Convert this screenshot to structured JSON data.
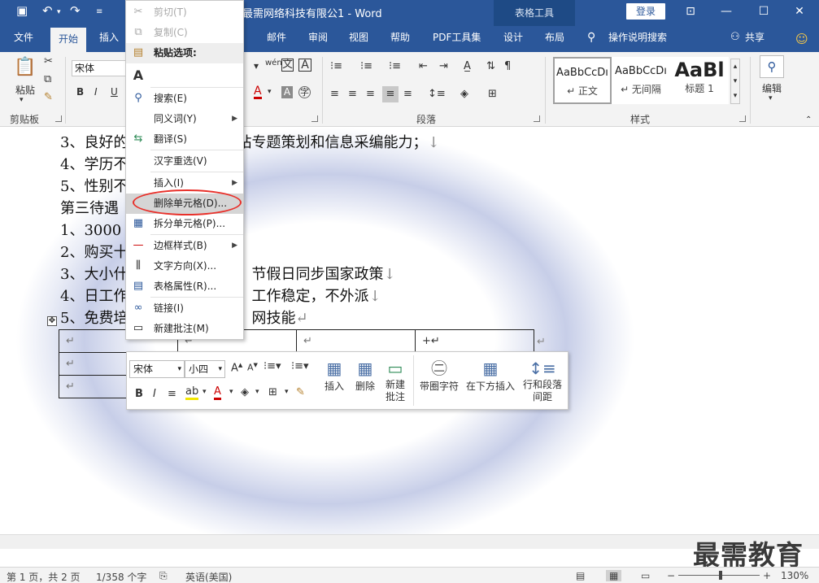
{
  "window": {
    "title": "最需网络科技有限公1 - Word",
    "context_tab_group": "表格工具",
    "login": "登录",
    "share": "共享",
    "tell_me": "操作说明搜索"
  },
  "tabs": [
    "文件",
    "开始",
    "插入",
    "邮件",
    "审阅",
    "视图",
    "帮助",
    "PDF工具集",
    "设计",
    "布局"
  ],
  "ribbon": {
    "clipboard": {
      "paste_label": "粘贴",
      "group_label": "剪贴板"
    },
    "font": {
      "name": "宋体"
    },
    "paragraph": {
      "group_label": "段落"
    },
    "styles": {
      "group_label": "样式",
      "items": [
        {
          "preview": "AaBbCcDı",
          "name": "↵ 正文"
        },
        {
          "preview": "AaBbCcDı",
          "name": "↵ 无间隔"
        },
        {
          "preview": "AaBl",
          "name": "标题 1"
        }
      ]
    },
    "editing": {
      "label": "编辑"
    }
  },
  "document": {
    "lines": [
      {
        "visible": "3、良好的",
        "tail": "强的网站专题策划和信息采编能力；",
        "mark": "↓"
      },
      {
        "visible": "4、学历不",
        "tail": "",
        "mark": ""
      },
      {
        "visible": "5、性别不",
        "tail": "",
        "mark": ""
      },
      {
        "visible": "第三待遇",
        "tail": "",
        "mark": ""
      },
      {
        "visible": "1、3000",
        "tail": "",
        "mark": ""
      },
      {
        "visible": "2、购买十",
        "tail": "",
        "mark": ""
      },
      {
        "visible": "3、大小什",
        "tail": "节假日同步国家政策",
        "mark": "↓"
      },
      {
        "visible": "4、日工作",
        "tail": "工作稳定，不外派",
        "mark": "↓"
      },
      {
        "visible": "5、免费培",
        "tail": "网技能",
        "mark": "↵"
      }
    ],
    "table_mark": "↵",
    "table_cursor_cell": "+↵"
  },
  "context_menu": {
    "items": [
      {
        "label": "剪切(T)",
        "icon": "scissors-icon",
        "glyph": "✂",
        "disabled": true
      },
      {
        "label": "复制(C)",
        "icon": "copy-icon",
        "glyph": "⧉",
        "disabled": true
      },
      {
        "label": "粘贴选项:",
        "icon": "clipboard-icon",
        "glyph": "📋",
        "bold": true
      },
      {
        "label": "",
        "icon": "paste-text-only-icon",
        "glyph": "A"
      },
      {
        "label": "搜索(E)",
        "icon": "search-icon",
        "glyph": "🔍"
      },
      {
        "label": "同义词(Y)",
        "icon": "",
        "glyph": "",
        "submenu": true
      },
      {
        "label": "翻译(S)",
        "icon": "translate-icon",
        "glyph": "⇆"
      },
      {
        "label": "汉字重选(V)",
        "icon": "",
        "glyph": ""
      },
      {
        "label": "插入(I)",
        "icon": "",
        "glyph": "",
        "submenu": true
      },
      {
        "label": "删除单元格(D)...",
        "icon": "",
        "glyph": "",
        "highlighted": true
      },
      {
        "label": "拆分单元格(P)...",
        "icon": "split-cells-icon",
        "glyph": "▦"
      },
      {
        "label": "边框样式(B)",
        "icon": "border-style-icon",
        "glyph": "—",
        "submenu": true
      },
      {
        "label": "文字方向(X)...",
        "icon": "text-direction-icon",
        "glyph": "⫼"
      },
      {
        "label": "表格属性(R)...",
        "icon": "table-properties-icon",
        "glyph": "▤"
      },
      {
        "label": "链接(I)",
        "icon": "link-icon",
        "glyph": "∞"
      },
      {
        "label": "新建批注(M)",
        "icon": "comment-icon",
        "glyph": "▭"
      }
    ]
  },
  "mini_toolbar": {
    "font": "宋体",
    "size": "小四",
    "buttons": [
      {
        "label": "插入",
        "icon": "insert-table-icon"
      },
      {
        "label": "删除",
        "icon": "delete-table-icon"
      },
      {
        "label": "新建\n批注",
        "line1": "新建",
        "line2": "批注",
        "icon": "new-comment-icon"
      },
      {
        "label": "带圈字符",
        "icon": "enclosed-char-icon"
      },
      {
        "label": "在下方插入",
        "icon": "insert-below-icon"
      },
      {
        "label": "行和段落间距",
        "line1": "行和段落",
        "line2": "间距",
        "icon": "line-spacing-icon"
      }
    ]
  },
  "statusbar": {
    "page": "第 1 页，共 2 页",
    "words": "1/358 个字",
    "language": "英语(美国)",
    "zoom": "130%"
  },
  "watermark": "最需教育",
  "colors": {
    "accent": "#2b579a",
    "highlight_circle": "#e8302a"
  }
}
